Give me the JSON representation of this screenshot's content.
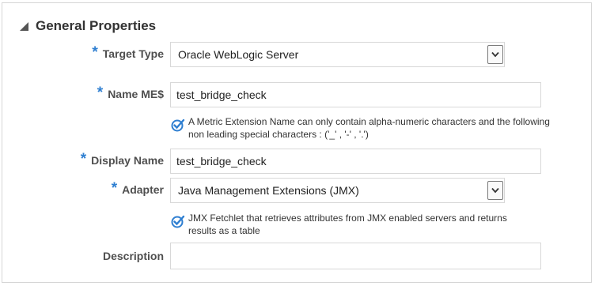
{
  "section": {
    "title": "General Properties"
  },
  "fields": {
    "target_type": {
      "label": "Target Type",
      "required_mark": "*",
      "value": "Oracle WebLogic Server"
    },
    "name": {
      "label": "Name ME$",
      "required_mark": "*",
      "value": "test_bridge_check",
      "hint": "A Metric Extension Name can only contain alpha-numeric characters and the following non leading special characters : ('_' , '-' , '.')"
    },
    "display_name": {
      "label": "Display Name",
      "required_mark": "*",
      "value": "test_bridge_check"
    },
    "adapter": {
      "label": "Adapter",
      "required_mark": "*",
      "value": "Java Management Extensions (JMX)",
      "hint": "JMX Fetchlet that retrieves attributes from JMX enabled servers and returns results as a table"
    },
    "description": {
      "label": "Description",
      "value": ""
    }
  },
  "colors": {
    "required": "#2f7fd1",
    "check": "#2f7fd1"
  },
  "icons": {
    "collapse": "triangle-down-icon",
    "check": "check-circle-icon",
    "dropdown": "chevron-down-icon"
  }
}
